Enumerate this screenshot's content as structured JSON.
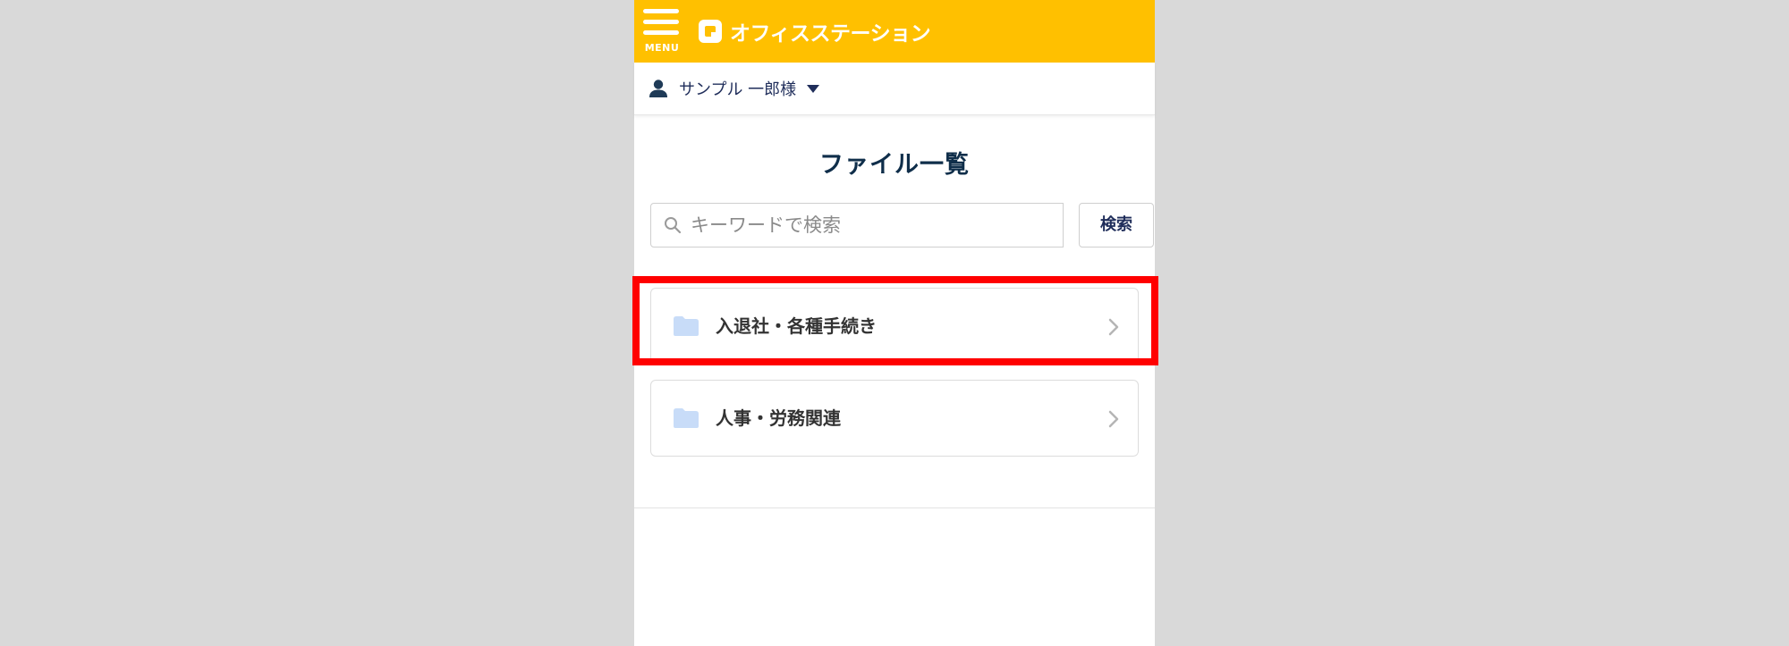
{
  "header": {
    "menu_label": "MENU",
    "app_name": "オフィスステーション",
    "icons": {
      "menu": "hamburger-icon",
      "logo": "office-station-logo-icon"
    },
    "accent_color": "#ffc000"
  },
  "user": {
    "name": "サンプル 一郎様",
    "icons": {
      "user": "person-icon",
      "dropdown": "caret-down-icon"
    }
  },
  "page": {
    "title": "ファイル一覧"
  },
  "search": {
    "placeholder": "キーワードで検索",
    "value": "",
    "button_label": "検索",
    "icon": "search-icon"
  },
  "folders": [
    {
      "label": "入退社・各種手続き",
      "icon": "folder-icon",
      "highlighted": true
    },
    {
      "label": "人事・労務関連",
      "icon": "folder-icon",
      "highlighted": false
    }
  ],
  "highlight_color": "#ff0000",
  "folder_color": "#c8dcf8"
}
